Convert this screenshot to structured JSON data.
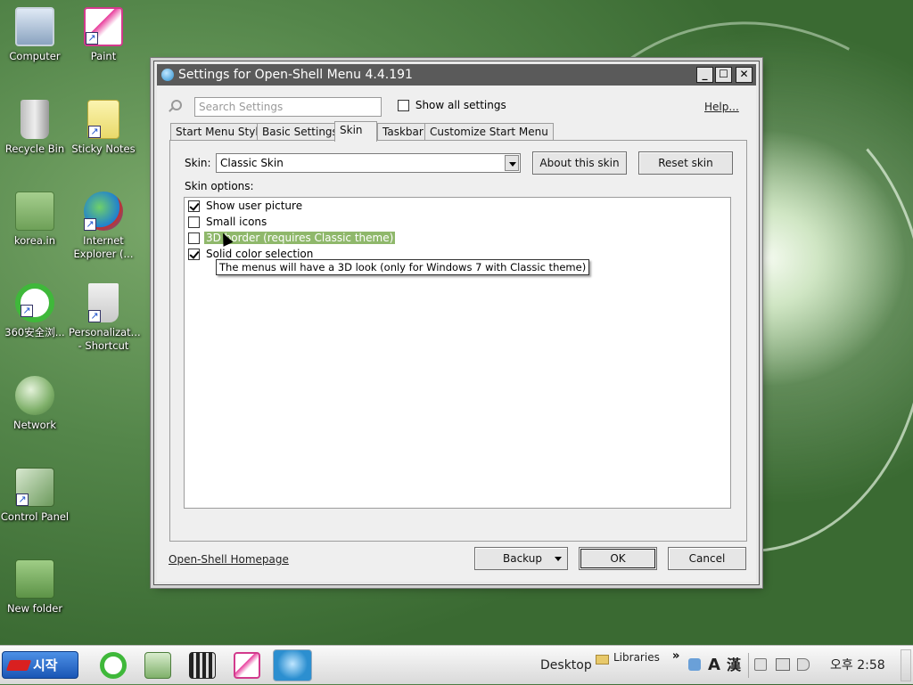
{
  "desktop": {
    "icons": [
      {
        "label": "Computer"
      },
      {
        "label": "Paint"
      },
      {
        "label": "Recycle Bin"
      },
      {
        "label": "Sticky Notes"
      },
      {
        "label": "korea.in"
      },
      {
        "label": "Internet Explorer (..."
      },
      {
        "label": "360安全浏..."
      },
      {
        "label": "Personalizat... - Shortcut"
      },
      {
        "label": "Network"
      },
      {
        "label": "Control Panel"
      },
      {
        "label": "New folder"
      }
    ]
  },
  "window": {
    "title": "Settings for Open-Shell Menu 4.4.191",
    "minimize_label": "_",
    "maximize_label": "☐",
    "close_label": "✕",
    "search": {
      "placeholder": "Search Settings"
    },
    "show_all_label": "Show all settings",
    "help_label": "Help...",
    "tabs": [
      {
        "label": "Start Menu Style"
      },
      {
        "label": "Basic Settings"
      },
      {
        "label": "Skin"
      },
      {
        "label": "Taskbar"
      },
      {
        "label": "Customize Start Menu"
      }
    ],
    "active_tab": "Skin",
    "skin_label": "Skin:",
    "skin_value": "Classic Skin",
    "about_skin_label": "About this skin",
    "reset_skin_label": "Reset skin",
    "skin_options_label": "Skin options:",
    "options": [
      {
        "label": "Show user picture",
        "checked": true
      },
      {
        "label": "Small icons",
        "checked": false
      },
      {
        "label": "3D border (requires Classic theme)",
        "checked": false
      },
      {
        "label": "Solid color selection",
        "checked": true
      }
    ],
    "tooltip": "The menus will have a 3D look (only for Windows 7 with Classic theme)",
    "homepage_link": "Open-Shell Homepage",
    "backup_label": "Backup",
    "ok_label": "OK",
    "cancel_label": "Cancel"
  },
  "taskbar": {
    "start_label": "시작",
    "desktop_label": "Desktop",
    "libraries_label": "Libraries",
    "chevron": "»",
    "ime_a": "A",
    "ime_han": "漢",
    "clock": "오후 2:58"
  },
  "colors": {
    "selection_highlight": "#8fb86b",
    "title_bar": "#5a5a5a"
  }
}
